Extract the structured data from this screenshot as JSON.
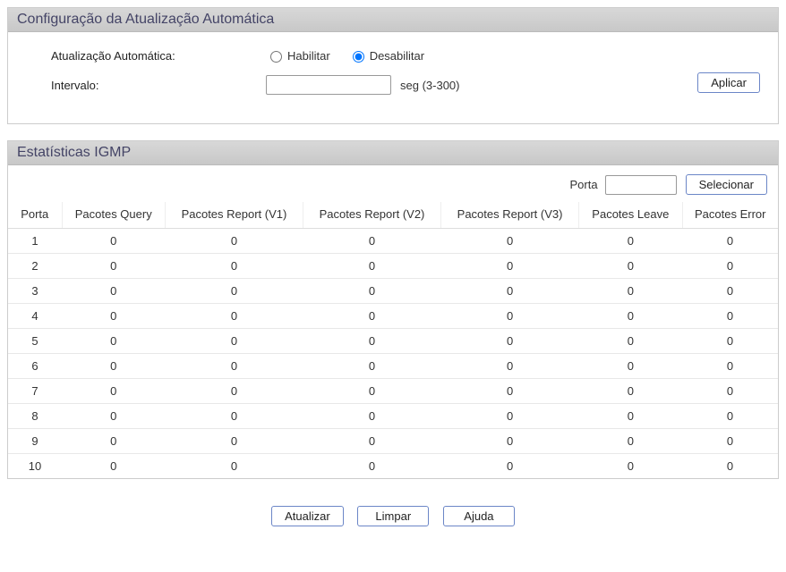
{
  "config": {
    "title": "Configuração da Atualização Automática",
    "auto_update_label": "Atualização Automática:",
    "enable_label": "Habilitar",
    "disable_label": "Desabilitar",
    "auto_update_selected": "disable",
    "interval_label": "Intervalo:",
    "interval_value": "",
    "interval_suffix": "seg (3-300)",
    "apply_label": "Aplicar"
  },
  "stats": {
    "title": "Estatísticas IGMP",
    "filter_label": "Porta",
    "filter_value": "",
    "select_label": "Selecionar",
    "columns": {
      "porta": "Porta",
      "query": "Pacotes Query",
      "report_v1": "Pacotes Report (V1)",
      "report_v2": "Pacotes Report (V2)",
      "report_v3": "Pacotes Report (V3)",
      "leave": "Pacotes Leave",
      "error": "Pacotes Error"
    },
    "rows": [
      {
        "porta": "1",
        "query": "0",
        "v1": "0",
        "v2": "0",
        "v3": "0",
        "leave": "0",
        "error": "0"
      },
      {
        "porta": "2",
        "query": "0",
        "v1": "0",
        "v2": "0",
        "v3": "0",
        "leave": "0",
        "error": "0"
      },
      {
        "porta": "3",
        "query": "0",
        "v1": "0",
        "v2": "0",
        "v3": "0",
        "leave": "0",
        "error": "0"
      },
      {
        "porta": "4",
        "query": "0",
        "v1": "0",
        "v2": "0",
        "v3": "0",
        "leave": "0",
        "error": "0"
      },
      {
        "porta": "5",
        "query": "0",
        "v1": "0",
        "v2": "0",
        "v3": "0",
        "leave": "0",
        "error": "0"
      },
      {
        "porta": "6",
        "query": "0",
        "v1": "0",
        "v2": "0",
        "v3": "0",
        "leave": "0",
        "error": "0"
      },
      {
        "porta": "7",
        "query": "0",
        "v1": "0",
        "v2": "0",
        "v3": "0",
        "leave": "0",
        "error": "0"
      },
      {
        "porta": "8",
        "query": "0",
        "v1": "0",
        "v2": "0",
        "v3": "0",
        "leave": "0",
        "error": "0"
      },
      {
        "porta": "9",
        "query": "0",
        "v1": "0",
        "v2": "0",
        "v3": "0",
        "leave": "0",
        "error": "0"
      },
      {
        "porta": "10",
        "query": "0",
        "v1": "0",
        "v2": "0",
        "v3": "0",
        "leave": "0",
        "error": "0"
      }
    ],
    "refresh_label": "Atualizar",
    "clear_label": "Limpar",
    "help_label": "Ajuda"
  }
}
